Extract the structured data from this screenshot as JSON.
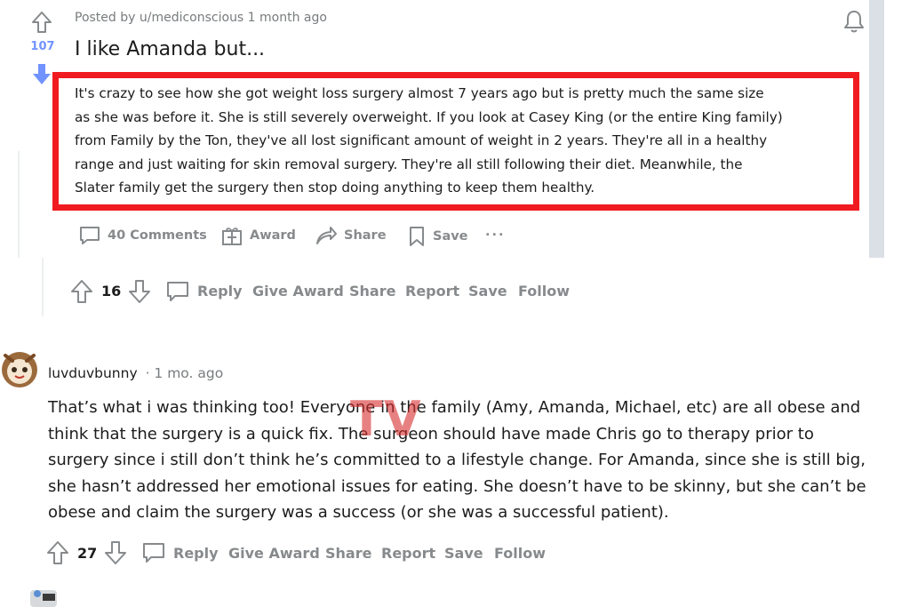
{
  "post": {
    "meta": "Posted by u/mediconscious 1 month ago",
    "score": "107",
    "title": "I like Amanda but...",
    "body_lines": [
      "It's crazy to see how she got weight loss surgery almost 7 years ago but is pretty much the same size",
      "as she was before it. She is still severely overweight. If you look at Casey King (or the entire King family)",
      "from Family by the Ton, they've all lost significant amount of weight in 2 years. They're all in a healthy",
      "range and just waiting for skin removal surgery. They're all still following their diet. Meanwhile, the",
      "Slater family get the surgery then stop doing anything to keep them healthy."
    ],
    "actions": {
      "comments": "40 Comments",
      "award": "Award",
      "share": "Share",
      "save": "Save",
      "more": "..."
    },
    "highlight_color": "#f01b20"
  },
  "reply1": {
    "score": "16",
    "actions": {
      "reply": "Reply",
      "give_award": "Give Award",
      "share": "Share",
      "report": "Report",
      "save": "Save",
      "follow": "Follow"
    }
  },
  "comment": {
    "username": "luvduvbunny",
    "time": "· 1 mo. ago",
    "lines": [
      "That’s what i was thinking too! Everyone in the family (Amy, Amanda, Michael, etc) are all obese and",
      "think that the surgery is a quick fix. The surgeon should have made Chris go to therapy prior to",
      "surgery since i still don’t think he’s committed to a lifestyle change. For Amanda, since she is still big,",
      "she hasn’t addressed her emotional issues for eating. She doesn’t have to be skinny, but she can’t be",
      "obese and claim the surgery was a success (or she was a successful patient)."
    ],
    "score": "27",
    "actions": {
      "reply": "Reply",
      "give_award": "Give Award",
      "share": "Share",
      "report": "Report",
      "save": "Save",
      "follow": "Follow"
    }
  },
  "watermark": "TV",
  "colors": {
    "downvote_active": "#7193ff",
    "muted": "#878a8c",
    "gutter": "#dae0e6"
  }
}
